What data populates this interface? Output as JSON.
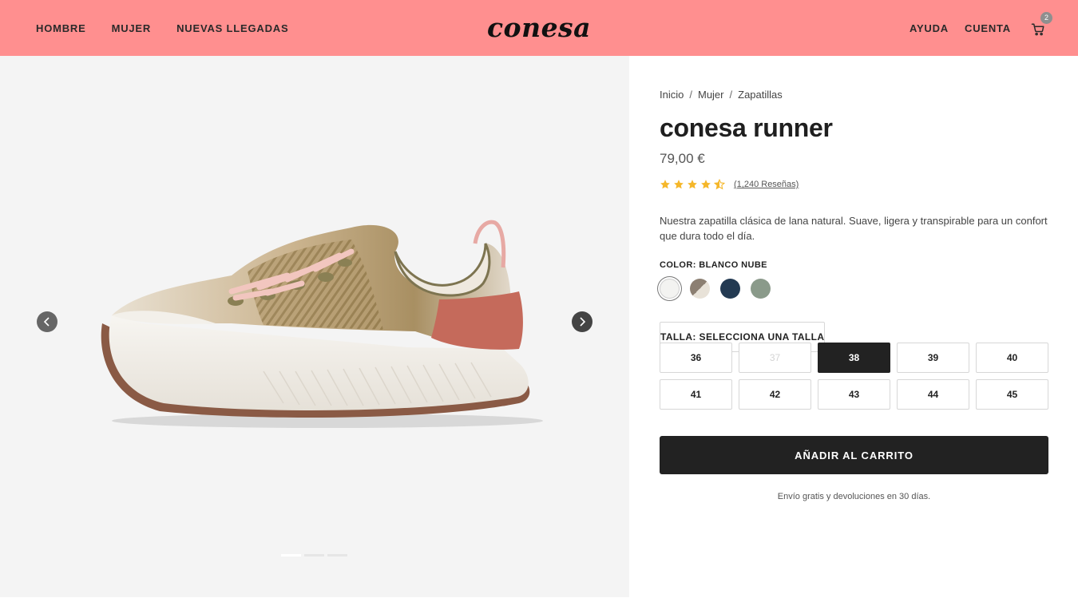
{
  "header": {
    "nav_left": [
      "HOMBRE",
      "MUJER",
      "NUEVAS LLEGADAS"
    ],
    "logo": "conesa",
    "help": "AYUDA",
    "account": "CUENTA",
    "cart_count": "2",
    "background_color": "#ff8f8f"
  },
  "gallery": {
    "image_subject": "sneaker",
    "slide_count": 3,
    "active_slide": 1
  },
  "product": {
    "breadcrumb": [
      "Inicio",
      "Mujer",
      "Zapatillas"
    ],
    "title": "conesa runner",
    "price": "79,00 €",
    "rating": 4.5,
    "reviews": "(1,240 Reseñas)",
    "description": "Nuestra zapatilla clásica de lana natural. Suave, ligera y transpirable para un confort que dura todo el día.",
    "color_label": "COLOR: BLANCO NUBE",
    "colors": [
      "#f3f3f1",
      "#8c7f72",
      "#233a52",
      "#8a9a8a"
    ],
    "selected_color_index": 0,
    "size_label": "TALLA: SELECCIONA UNA TALLA",
    "sizes": [
      "36",
      "37",
      "38",
      "39",
      "40",
      "41",
      "42",
      "43",
      "44",
      "45"
    ],
    "disabled_size": "37",
    "selected_size": "38",
    "add_to_cart": "AÑADIR AL CARRITO",
    "shipping_note": "Envío gratis y devoluciones en 30 días."
  }
}
